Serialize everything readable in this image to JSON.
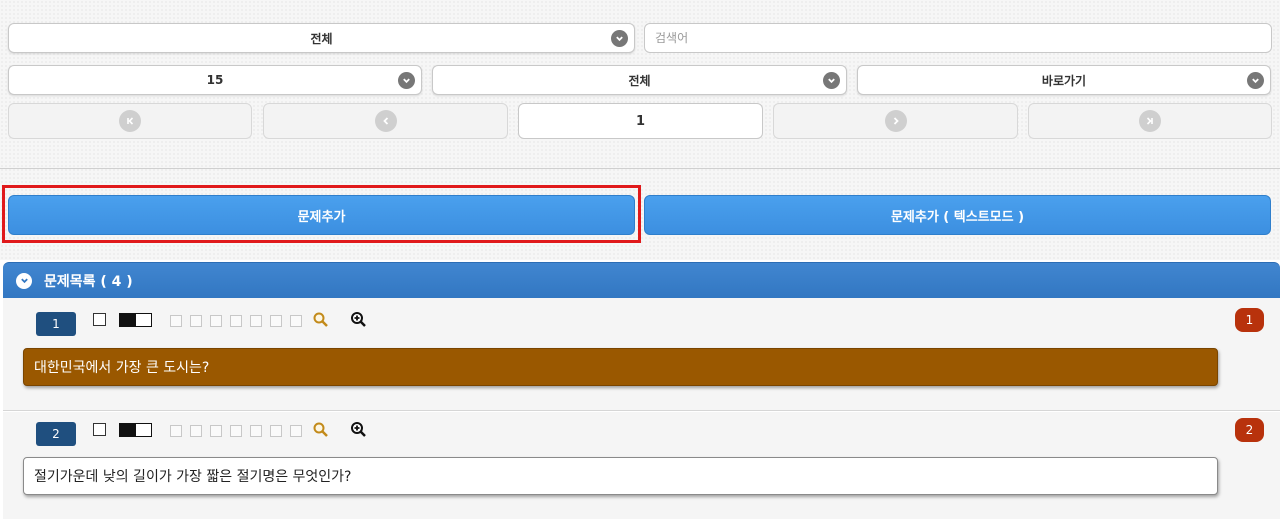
{
  "filters": {
    "category_select": "전체",
    "search_placeholder": "검색어",
    "page_size_select": "15",
    "type_select": "전체",
    "goto_select": "바로가기"
  },
  "pagination": {
    "current_page": "1"
  },
  "actions": {
    "add_question": "문제추가",
    "add_question_text_mode": "문제추가 ( 텍스트모드 )"
  },
  "question_list": {
    "title": "문제목록 ( 4 )",
    "items": [
      {
        "number": "1",
        "count": "1",
        "text": "대한민국에서 가장 큰 도시는?",
        "box_color": "#9a5800",
        "text_color": "#ffffff"
      },
      {
        "number": "2",
        "count": "2",
        "text": "절기가운데 낮의 길이가 가장 짧은 절기명은 무엇인가?",
        "box_color": "#ffffff",
        "text_color": "#222222"
      }
    ]
  },
  "colors": {
    "accent_blue": "#3c8fe0",
    "header_blue": "#3277c2",
    "highlight_red": "#e0191b",
    "count_badge": "#b8320c",
    "number_badge": "#1f4f7f"
  },
  "icons": {
    "first": "first-page-icon",
    "prev": "prev-page-icon",
    "next": "next-page-icon",
    "last": "last-page-icon",
    "dropdown": "chevron-down-icon",
    "search": "magnifier-icon",
    "zoom": "zoom-in-icon"
  }
}
